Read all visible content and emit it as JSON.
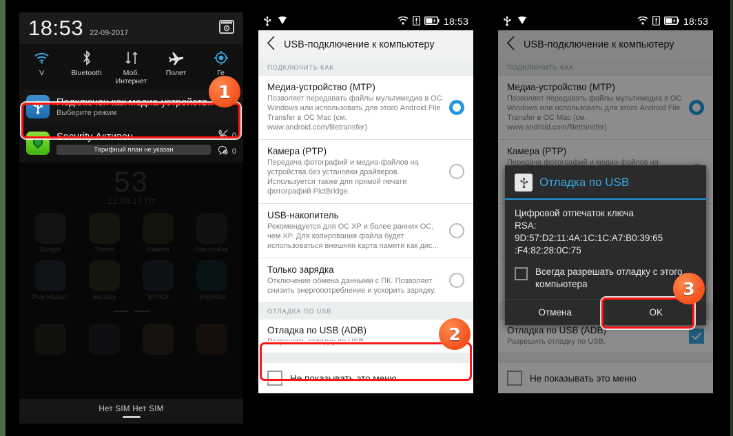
{
  "colors": {
    "accent_blue": "#2196e3",
    "badge_orange": "#f4501b",
    "highlight_red": "#ff1414",
    "checkbox_blue": "#36a9e1"
  },
  "statusbar": {
    "time": "18:53",
    "icons_left": [
      "usb-icon",
      "download-icon"
    ],
    "icons_right": [
      "wifi-icon",
      "sim-alert-icon",
      "battery-icon"
    ]
  },
  "panel1": {
    "shade": {
      "clock": "18:53",
      "date": "22-09-2017",
      "settings_icon": "gear-screenshot-icon",
      "quick_settings": [
        {
          "label": "V",
          "icon": "wifi-icon",
          "active": true
        },
        {
          "label": "Bluetooth",
          "icon": "bluetooth-icon",
          "active": false
        },
        {
          "label": "Моб. Интернет",
          "icon": "data-transfer-icon",
          "active": false
        },
        {
          "label": "Полет",
          "icon": "airplane-icon",
          "active": false
        },
        {
          "label": "Ге",
          "icon": "location-icon",
          "active": true
        }
      ],
      "notifications": [
        {
          "icon": "usb-icon",
          "title": "Подключен как медиа-устройств..",
          "subtitle": "Выберите режим"
        },
        {
          "icon": "security-shield-icon",
          "title": "Security Активен",
          "plan": "Тарифный план не указан",
          "counters": [
            {
              "icon": "missed-call-icon",
              "value": "0"
            },
            {
              "icon": "blocked-message-icon",
              "value": "0"
            }
          ]
        }
      ]
    },
    "home": {
      "clock": "53",
      "date": "22.09.17  Пт",
      "apps_row1": [
        {
          "label": "Google",
          "color": "#2d2d2d"
        },
        {
          "label": "Theme",
          "color": "#3a3520"
        },
        {
          "label": "Камера",
          "color": "#332d16"
        },
        {
          "label": "Настройки",
          "color": "#2b2b2b"
        }
      ],
      "apps_row2": [
        {
          "label": "Play Маркет",
          "color": "#243040"
        },
        {
          "label": "Security",
          "color": "#2e3a17"
        },
        {
          "label": "SYNCit",
          "color": "#20303c"
        },
        {
          "label": "SHAREit",
          "color": "#123034"
        }
      ],
      "apps_row3": [
        {
          "label": "",
          "color": "#2a2a20"
        },
        {
          "label": "",
          "color": "#1e2630"
        },
        {
          "label": "",
          "color": "#3a3320"
        },
        {
          "label": "",
          "color": "#3a2018"
        }
      ],
      "navbar_sims": "Нет SIM   Нет SIM"
    }
  },
  "settings_screen": {
    "back_icon": "chevron-left-icon",
    "title": "USB-подключение к компьютеру",
    "section_connect_as": "ПОДКЛЮЧИТЬ КАК",
    "options": [
      {
        "title": "Медиа-устройство (MTP)",
        "desc": "Позволяет передавать файлы мультимедиа в ОС Windows или использовать для этого Android File Transfer в ОС Mac (см. www.android.com/filetransfer)",
        "selected": true
      },
      {
        "title": "Камера (PTP)",
        "desc": "Передача фотографий и медиа-файлов на устройства без установки драйверов. Используется также для прямой печати фотографий PictBridge.",
        "selected": false
      },
      {
        "title": "USB-накопитель",
        "desc": "Рекомендуется для ОС XP и более ранних ОС, чем XP. Для копирования файла будет использоваться внешняя карта памяти как дис...",
        "selected": false
      },
      {
        "title": "Только зарядка",
        "desc": "Отключение обмена данными с ПК. Позволяет снизить энергопотребление и ускорить зарядку.",
        "selected": false
      }
    ],
    "section_usb_debug": "ОТЛАДКА ПО USB",
    "adb": {
      "title": "Отладка по USB (ADB)",
      "desc": "Разрешить отладку по USB.",
      "checked": true
    },
    "dont_show_menu": {
      "label": "Не показывать это меню",
      "checked": false
    }
  },
  "dialog": {
    "icon": "usb-icon",
    "title": "Отладка по USB",
    "body_line1": "Цифровой отпечаток ключа",
    "body_line2": "RSA:",
    "body_line3": "9D:57:D2:11:4A:1C:1C:A7:B0:39:65",
    "body_line4": ":F4:82:28:0C:75",
    "checkbox_label": "Всегда разрешать отладку с этого компьютера",
    "checkbox_checked": false,
    "cancel_label": "Отмена",
    "ok_label": "OK"
  },
  "annotations": {
    "steps": [
      {
        "number": "1"
      },
      {
        "number": "2"
      },
      {
        "number": "3"
      }
    ]
  }
}
